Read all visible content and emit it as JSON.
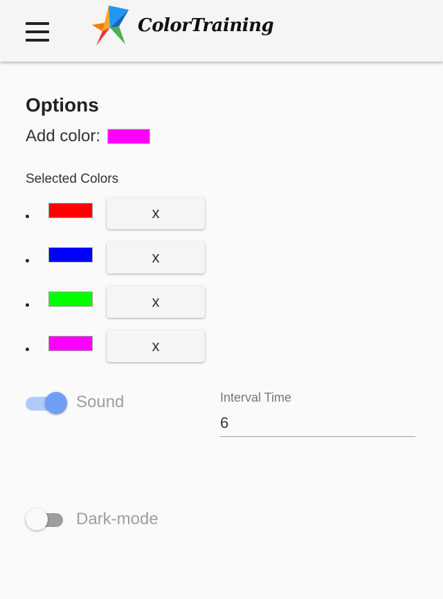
{
  "header": {
    "brand": "ColorTraining",
    "menu_icon": "hamburger-menu-icon",
    "logo_icon": "multicolor-star-logo"
  },
  "options": {
    "heading": "Options",
    "add_color_label": "Add color:",
    "add_color_value": "#ff00ff",
    "selected_label": "Selected Colors",
    "selected_colors": [
      {
        "color": "#ff0000",
        "remove_label": "x"
      },
      {
        "color": "#0000ff",
        "remove_label": "x"
      },
      {
        "color": "#00ff00",
        "remove_label": "x"
      },
      {
        "color": "#ff00ff",
        "remove_label": "x"
      }
    ],
    "sound": {
      "label": "Sound",
      "enabled": true
    },
    "interval": {
      "label": "Interval Time",
      "value": "6"
    },
    "dark_mode": {
      "label": "Dark-mode",
      "enabled": false
    }
  }
}
